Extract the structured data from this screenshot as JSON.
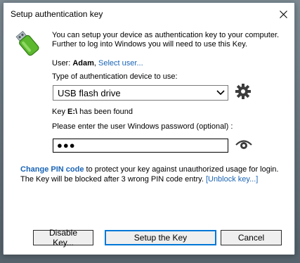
{
  "window": {
    "title": "Setup authentication key",
    "close_icon": "close-icon"
  },
  "content": {
    "intro_line_1": "You can setup your device as authentication key to your computer.",
    "intro_line_2": "Further to log into Windows you will need to use this Key.",
    "user_label": "User: ",
    "user_name": "Adam",
    "user_separator": ",",
    "select_user_link": "Select user...",
    "device_type_label": "Type of authentication device to use:",
    "device_type_value": "USB flash drive",
    "key_found_prefix": "Key ",
    "key_drive": "E:\\",
    "key_found_suffix": " has been found",
    "password_label": "Please enter the user Windows password (optional) :",
    "password_value": "●●●",
    "change_pin_link": "Change PIN code",
    "pin_text_1": " to protect your key against unauthorized usage for login.",
    "pin_text_2": "The Key will be blocked after 3 wrong PIN code entry.",
    "unblock_link": "[Unblock key...]"
  },
  "buttons": {
    "disable": "Disable Key...",
    "setup": "Setup the Key",
    "cancel": "Cancel"
  },
  "colors": {
    "link": "#1a64b5",
    "accent": "#0078d7",
    "icon_gray": "#3c3c3c"
  }
}
